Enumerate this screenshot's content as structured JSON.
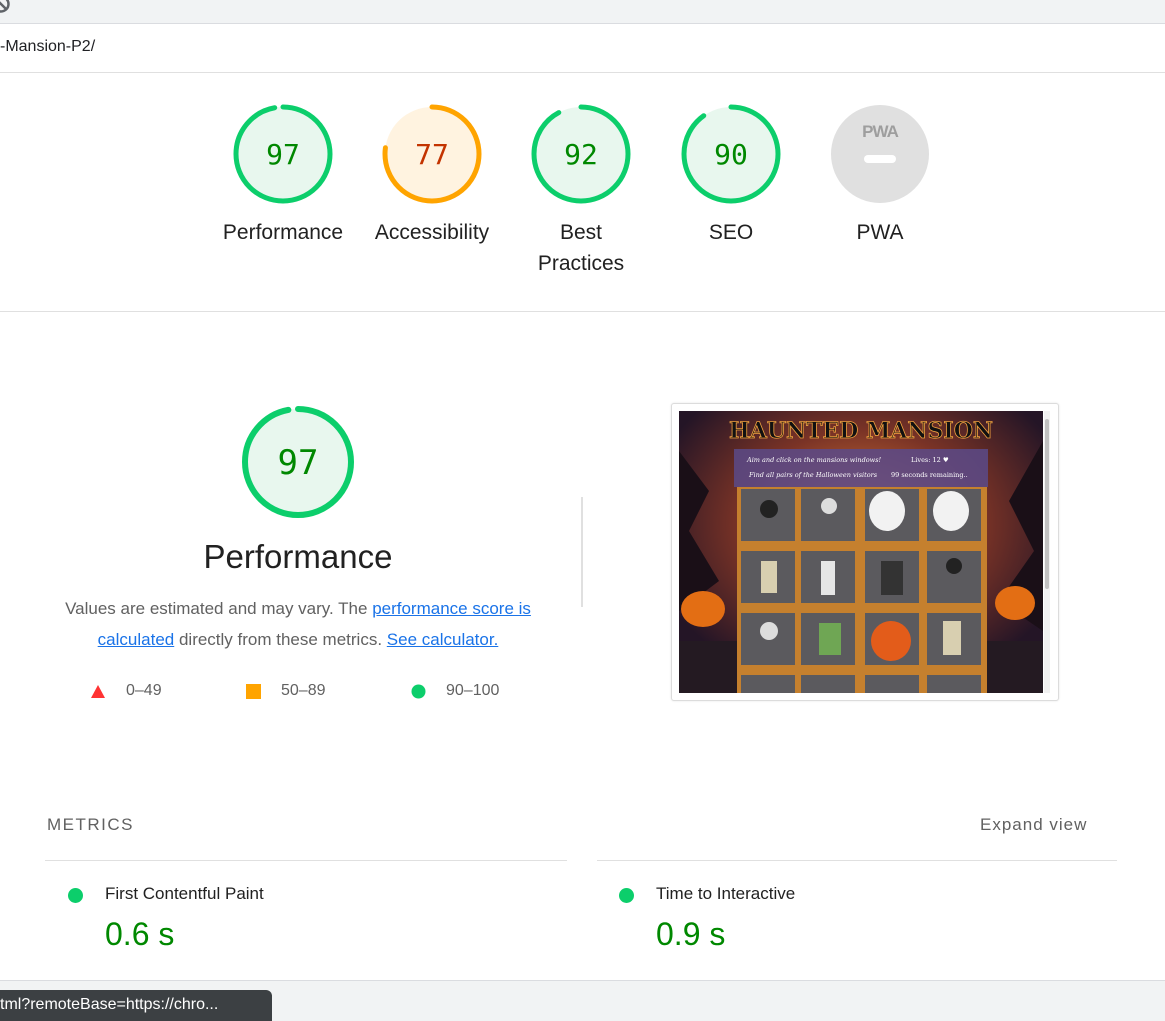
{
  "browser": {
    "url_fragment": "-Mansion-P2/",
    "status_url": "tml?remoteBase=https://chro..."
  },
  "colors": {
    "pass": "#0cce6b",
    "pass_text": "#008800",
    "pass_fill": "#e8f7ee",
    "average": "#ffa400",
    "average_text": "#c33300",
    "average_fill": "#fff3e0",
    "fail": "#ff3333",
    "na": "#e0e0e0",
    "link": "#1a73e8"
  },
  "gauges": [
    {
      "score": 97,
      "label": "Performance",
      "rating": "pass"
    },
    {
      "score": 77,
      "label": "Accessibility",
      "rating": "average"
    },
    {
      "score": 92,
      "label": "Best Practices",
      "rating": "pass"
    },
    {
      "score": 90,
      "label": "SEO",
      "rating": "pass"
    },
    {
      "score": null,
      "label": "PWA",
      "rating": "na",
      "badge": "PWA"
    }
  ],
  "performance": {
    "score": 97,
    "title": "Performance",
    "desc_prefix": "Values are estimated and may vary. The ",
    "desc_link1": "performance score is calculated",
    "desc_middle": " directly from these metrics. ",
    "desc_link2": "See calculator.",
    "legend": [
      {
        "range": "0–49",
        "icon": "fail-triangle-icon"
      },
      {
        "range": "50–89",
        "icon": "average-square-icon"
      },
      {
        "range": "90–100",
        "icon": "pass-circle-icon"
      }
    ]
  },
  "screenshot": {
    "title": "HAUNTED MANSION",
    "line1_left": "Aim and click on the mansions windows!",
    "line1_right": "Lives: 12 ♥",
    "line2_left": "Find all pairs of the Halloween visitors",
    "line2_right": "99 seconds remaining.."
  },
  "metrics": {
    "heading": "METRICS",
    "expand_label": "Expand view",
    "items": [
      {
        "name": "First Contentful Paint",
        "value": "0.6 s"
      },
      {
        "name": "Time to Interactive",
        "value": "0.9 s"
      }
    ]
  }
}
